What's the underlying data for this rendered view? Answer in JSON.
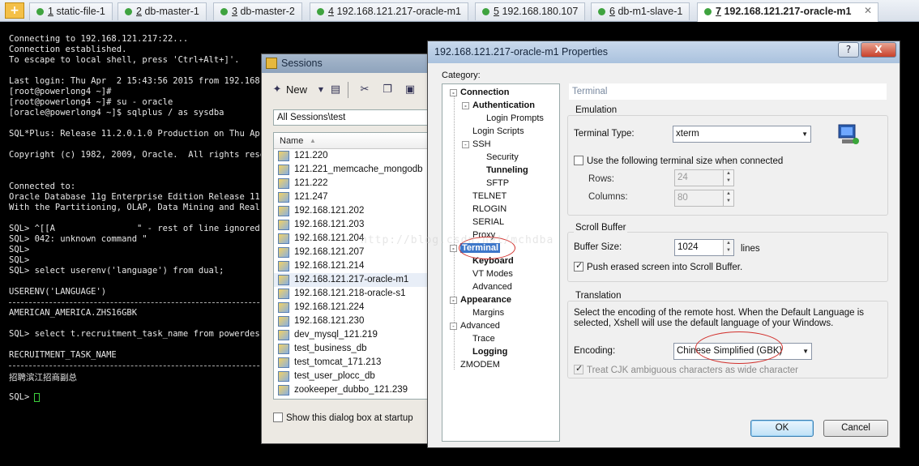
{
  "tabs": [
    {
      "num": "1",
      "label": "static-file-1"
    },
    {
      "num": "2",
      "label": "db-master-1"
    },
    {
      "num": "3",
      "label": "db-master-2"
    },
    {
      "num": "4",
      "label": "192.168.121.217-oracle-m1"
    },
    {
      "num": "5",
      "label": "192.168.180.107"
    },
    {
      "num": "6",
      "label": "db-m1-slave-1"
    },
    {
      "num": "7",
      "label": "192.168.121.217-oracle-m1"
    }
  ],
  "terminal": {
    "lines": [
      "Connecting to 192.168.121.217:22...",
      "Connection established.",
      "To escape to local shell, press 'Ctrl+Alt+]'.",
      "",
      "Last login: Thu Apr  2 15:43:56 2015 from 192.168.12",
      "[root@powerlong4 ~]#",
      "[root@powerlong4 ~]# su - oracle",
      "[oracle@powerlong4 ~]$ sqlplus / as sysdba",
      "",
      "SQL*Plus: Release 11.2.0.1.0 Production on Thu Apr 2",
      "",
      "Copyright (c) 1982, 2009, Oracle.  All rights reserv",
      "",
      "",
      "Connected to:",
      "Oracle Database 11g Enterprise Edition Release 11.2.",
      "With the Partitioning, OLAP, Data Mining and Real Ap",
      "",
      "SQL> ^[[A                \" - rest of line ignored.",
      "SQL> 042: unknown command \"",
      "SQL>",
      "SQL>",
      "SQL> select userenv('language') from dual;",
      "",
      "USERENV('LANGUAGE')",
      "",
      "AMERICAN_AMERICA.ZHS16GBK",
      "",
      "SQL> select t.recruitment_task_name from powerdesk.",
      "",
      "RECRUITMENT_TASK_NAME",
      "",
      "招聘滨江招商副总",
      "",
      "SQL> "
    ],
    "watermark": "http://blog.csdn.net/mchdba"
  },
  "sessions": {
    "title": "Sessions",
    "new_label": "New",
    "path": "All Sessions\\test",
    "column_name": "Name",
    "items": [
      "121.220",
      "121.221_memcache_mongodb",
      "121.222",
      "121.247",
      "192.168.121.202",
      "192.168.121.203",
      "192.168.121.204",
      "192.168.121.207",
      "192.168.121.214",
      "192.168.121.217-oracle-m1",
      "192.168.121.218-oracle-s1",
      "192.168.121.224",
      "192.168.121.230",
      "dev_mysql_121.219",
      "test_business_db",
      "test_tomcat_171.213",
      "test_user_plocc_db",
      "zookeeper_dubbo_121.239"
    ],
    "selected_index": 9,
    "startup_label": "Show this dialog box at startup"
  },
  "props": {
    "title": "192.168.121.217-oracle-m1 Properties",
    "help": "?",
    "close": "X",
    "category_label": "Category:",
    "tree": [
      {
        "label": "Connection",
        "bold": true,
        "level": 0,
        "exp": "-"
      },
      {
        "label": "Authentication",
        "bold": true,
        "level": 1,
        "exp": "-"
      },
      {
        "label": "Login Prompts",
        "bold": false,
        "level": 2
      },
      {
        "label": "Login Scripts",
        "bold": false,
        "level": 1
      },
      {
        "label": "SSH",
        "bold": false,
        "level": 1,
        "exp": "-"
      },
      {
        "label": "Security",
        "bold": false,
        "level": 2
      },
      {
        "label": "Tunneling",
        "bold": true,
        "level": 2
      },
      {
        "label": "SFTP",
        "bold": false,
        "level": 2
      },
      {
        "label": "TELNET",
        "bold": false,
        "level": 1
      },
      {
        "label": "RLOGIN",
        "bold": false,
        "level": 1
      },
      {
        "label": "SERIAL",
        "bold": false,
        "level": 1
      },
      {
        "label": "Proxy",
        "bold": false,
        "level": 1
      },
      {
        "label": "Terminal",
        "bold": true,
        "level": 0,
        "exp": "-",
        "selected": true
      },
      {
        "label": "Keyboard",
        "bold": true,
        "level": 1
      },
      {
        "label": "VT Modes",
        "bold": false,
        "level": 1
      },
      {
        "label": "Advanced",
        "bold": false,
        "level": 1
      },
      {
        "label": "Appearance",
        "bold": true,
        "level": 0,
        "exp": "-"
      },
      {
        "label": "Margins",
        "bold": false,
        "level": 1
      },
      {
        "label": "Advanced",
        "bold": false,
        "level": 0,
        "exp": "-"
      },
      {
        "label": "Trace",
        "bold": false,
        "level": 1
      },
      {
        "label": "Logging",
        "bold": true,
        "level": 1
      },
      {
        "label": "ZMODEM",
        "bold": false,
        "level": 0
      }
    ],
    "panel_title": "Terminal",
    "emulation": {
      "group": "Emulation",
      "type_label": "Terminal Type:",
      "type_value": "xterm",
      "use_size_label": "Use the following terminal size when connected",
      "rows_label": "Rows:",
      "rows_value": "24",
      "cols_label": "Columns:",
      "cols_value": "80"
    },
    "scroll": {
      "group": "Scroll Buffer",
      "size_label": "Buffer Size:",
      "size_value": "1024",
      "unit": "lines",
      "push_label": "Push erased screen into Scroll Buffer."
    },
    "translation": {
      "group": "Translation",
      "desc": "Select the encoding of the remote host. When the Default Language is selected, Xshell will use the default language of your Windows.",
      "enc_label": "Encoding:",
      "enc_value": "Chinese Simplified (GBK)",
      "cjk_label": "Treat CJK ambiguous characters as wide character"
    },
    "ok": "OK",
    "cancel": "Cancel"
  }
}
